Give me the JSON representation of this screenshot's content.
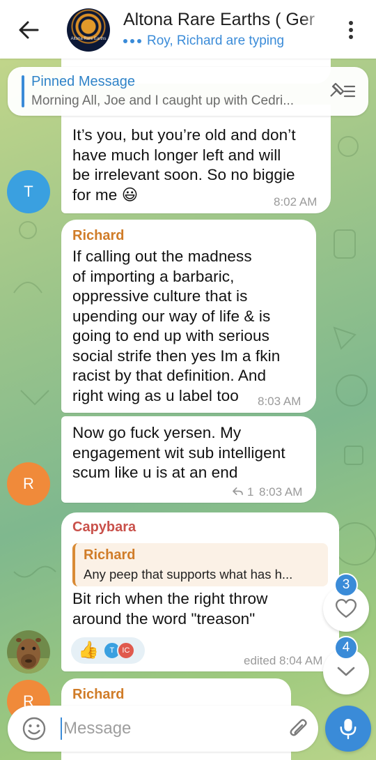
{
  "header": {
    "title": "Altona Rare Earths ( Ger",
    "logo_text": "Altona Rare Earths",
    "typing_status": "Roy, Richard are typing",
    "back_icon": "back-arrow-icon",
    "more_icon": "more-vertical-icon"
  },
  "pinned": {
    "title": "Pinned Message",
    "text": "Morning All,  Joe and I caught up with Cedri...",
    "icon": "unpin-list-icon"
  },
  "messages": [
    {
      "text_lines": [
        "It’s you, but you’re old and don’t",
        "have much longer left and will",
        "be irrelevant soon. So no biggie",
        "for me 😃"
      ],
      "time": "8:02 AM",
      "avatar_letter": "T",
      "avatar_color": "#3aa0e0"
    },
    {
      "sender": "Richard",
      "sender_color": "#d07c28",
      "text_lines": [
        "If calling out the madness",
        "of importing a barbaric,",
        "oppressive culture that is",
        "upending our way of life & is",
        "going to end up with serious",
        "social strife then yes Im a fkin",
        "racist by that definition. And",
        "right wing as u label too"
      ],
      "time": "8:03 AM"
    },
    {
      "text_lines": [
        "Now go fuck yersen. My",
        "engagement wit sub intelligent",
        "scum like u is at an end"
      ],
      "reply_count": "1",
      "time": "8:03 AM",
      "avatar_letter": "R",
      "avatar_color": "#f08a3a"
    },
    {
      "sender": "Capybara",
      "sender_color": "#c9514b",
      "reply": {
        "name": "Richard",
        "text": "Any peep that supports what has h..."
      },
      "text_lines": [
        "Bit rich when the right throw",
        "around the word \"treason\""
      ],
      "reactions": {
        "emoji": "👍",
        "avatars": [
          {
            "letter": "T",
            "color": "#3aa0e0"
          },
          {
            "letter": "IC",
            "color": "#e05a4e"
          }
        ]
      },
      "time": "edited 8:04 AM"
    },
    {
      "sender": "Richard",
      "sender_color": "#d07c28",
      "avatar_letter": "R",
      "avatar_color": "#f08a3a"
    }
  ],
  "floating": {
    "reactions_badge": "3",
    "reactions_icon": "heart-icon",
    "scroll_badge": "4",
    "scroll_icon": "chevron-down-icon"
  },
  "composer": {
    "placeholder": "Message",
    "emoji_icon": "smiley-icon",
    "attach_icon": "paperclip-icon",
    "mic_icon": "microphone-icon"
  },
  "colors": {
    "accent": "#3a8bd8",
    "bubble": "#ffffff"
  }
}
